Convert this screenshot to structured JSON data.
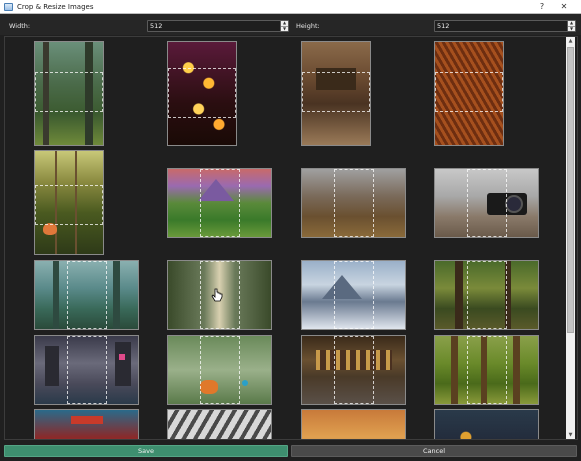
{
  "window": {
    "title": "Crop & Resize Images",
    "help_label": "?",
    "close_label": "✕"
  },
  "toolbar": {
    "width_label": "Width:",
    "width_value": "512",
    "height_label": "Height:",
    "height_value": "512"
  },
  "gallery": {
    "thumbnails": [
      {
        "name": "forest-path-with-figure",
        "orientation": "portrait"
      },
      {
        "name": "bokeh-lights",
        "orientation": "portrait"
      },
      {
        "name": "abandoned-room",
        "orientation": "portrait"
      },
      {
        "name": "autumn-leaves-texture",
        "orientation": "portrait"
      },
      {
        "name": "vines-with-butterfly",
        "orientation": "portrait"
      },
      {
        "name": "fantasy-mountain-valley",
        "orientation": "landscape"
      },
      {
        "name": "autumn-forest",
        "orientation": "landscape"
      },
      {
        "name": "camera-on-gravel",
        "orientation": "landscape"
      },
      {
        "name": "misty-teal-forest",
        "orientation": "landscape"
      },
      {
        "name": "overgrown-alley",
        "orientation": "landscape"
      },
      {
        "name": "snowy-mountains",
        "orientation": "landscape"
      },
      {
        "name": "forest-trunks-bokeh",
        "orientation": "landscape"
      },
      {
        "name": "city-street-night",
        "orientation": "landscape"
      },
      {
        "name": "butterflies-hanging",
        "orientation": "landscape"
      },
      {
        "name": "arched-building-street",
        "orientation": "landscape"
      },
      {
        "name": "green-forest",
        "orientation": "landscape"
      },
      {
        "name": "red-temple",
        "orientation": "landscape"
      },
      {
        "name": "architecture-lines",
        "orientation": "landscape"
      },
      {
        "name": "sunset-blur",
        "orientation": "landscape"
      },
      {
        "name": "bokeh-street-lights",
        "orientation": "landscape"
      }
    ]
  },
  "actions": {
    "save_label": "Save",
    "cancel_label": "Cancel"
  },
  "colors": {
    "accent_save": "#3e8f6f",
    "cancel_bg": "#4a4a4a",
    "background": "#202020"
  },
  "icons": {
    "app": "app-window-icon",
    "help": "help-icon",
    "close": "close-icon",
    "cursor": "hand-cursor-icon"
  }
}
